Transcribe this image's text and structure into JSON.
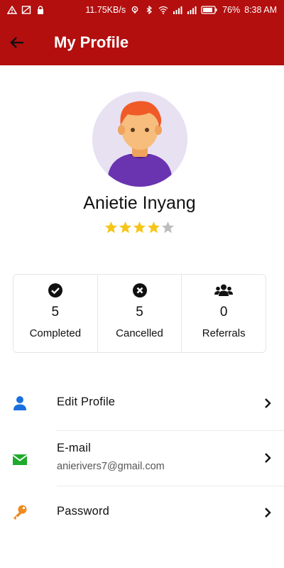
{
  "status_bar": {
    "network_speed": "11.75KB/s",
    "battery": "76%",
    "time": "8:38 AM"
  },
  "app_bar": {
    "title": "My Profile"
  },
  "profile": {
    "name": "Anietie Inyang",
    "rating": 4,
    "rating_max": 5
  },
  "stats": [
    {
      "icon": "check-circle-icon",
      "value": "5",
      "label": "Completed"
    },
    {
      "icon": "x-circle-icon",
      "value": "5",
      "label": "Cancelled"
    },
    {
      "icon": "users-icon",
      "value": "0",
      "label": "Referrals"
    }
  ],
  "menu": {
    "edit_profile": {
      "label": "Edit Profile",
      "icon": "user-icon"
    },
    "email": {
      "label": "E-mail",
      "value": "anierivers7@gmail.com",
      "icon": "envelope-icon"
    },
    "password": {
      "label": "Password",
      "icon": "key-icon"
    }
  },
  "colors": {
    "app_bar": "#b30f0f",
    "star_filled": "#f5c518",
    "star_empty": "#bdbdbd",
    "user_icon": "#1a6fe0",
    "email_icon": "#1faa2e",
    "key_icon": "#f08a1e"
  }
}
